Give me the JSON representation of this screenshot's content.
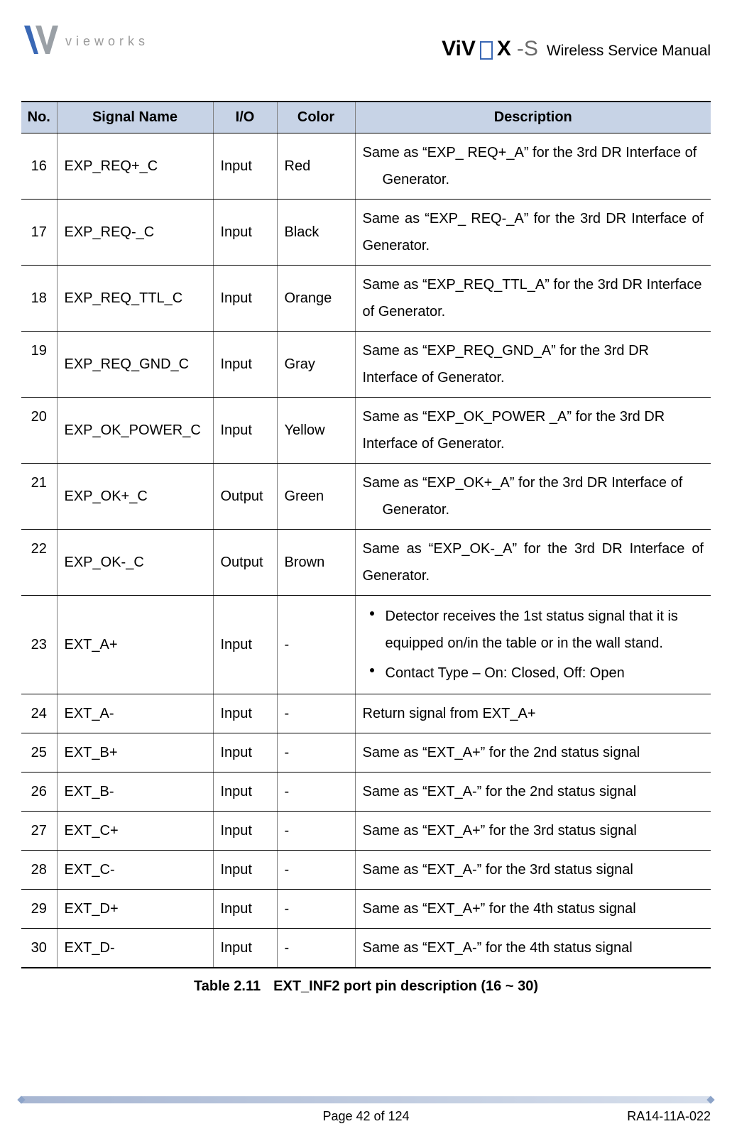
{
  "header": {
    "company_wordmark": "vieworks",
    "product_logo_text_left": "ViV",
    "product_logo_text_right": "X",
    "product_logo_suffix": "-S",
    "manual_title": "Wireless Service Manual"
  },
  "table": {
    "headers": {
      "no": "No.",
      "signal": "Signal Name",
      "io": "I/O",
      "color": "Color",
      "description": "Description"
    },
    "rows": [
      {
        "no": "16",
        "signal": "EXP_REQ+_C",
        "io": "Input",
        "color": "Red",
        "desc_prefix": "Same as “EXP_ REQ+_A” for the 3rd DR Interface of",
        "desc_indent": "Generator."
      },
      {
        "no": "17",
        "signal": "EXP_REQ-_C",
        "io": "Input",
        "color": "Black",
        "desc": "Same as “EXP_ REQ-_A” for the 3rd DR Interface of Generator.",
        "justify": true
      },
      {
        "no": "18",
        "signal": "EXP_REQ_TTL_C",
        "io": "Input",
        "color": "Orange",
        "desc": "Same as “EXP_REQ_TTL_A” for the 3rd DR Interface of Generator."
      },
      {
        "no": "19",
        "signal": "EXP_REQ_GND_C",
        "io": "Input",
        "color": "Gray",
        "desc": "Same as “EXP_REQ_GND_A” for the 3rd DR Interface of Generator.",
        "no_top": true
      },
      {
        "no": "20",
        "signal": "EXP_OK_POWER_C",
        "io": "Input",
        "color": "Yellow",
        "desc": "Same as “EXP_OK_POWER _A” for the 3rd DR Interface of Generator.",
        "no_top": true
      },
      {
        "no": "21",
        "signal": "EXP_OK+_C",
        "io": "Output",
        "color": "Green",
        "desc_prefix": "Same as “EXP_OK+_A” for the 3rd DR Interface of",
        "desc_indent": "Generator.",
        "no_top": true
      },
      {
        "no": "22",
        "signal": "EXP_OK-_C",
        "io": "Output",
        "color": "Brown",
        "desc": "Same as “EXP_OK-_A” for the 3rd DR Interface of Generator.",
        "justify": true,
        "no_top": true
      },
      {
        "no": "23",
        "signal": "EXT_A+",
        "io": "Input",
        "color": "-",
        "bullets": [
          "Detector receives the 1st status signal that it is equipped on/in the table or in the wall stand.",
          "Contact Type – On: Closed, Off: Open"
        ]
      },
      {
        "no": "24",
        "signal": "EXT_A-",
        "io": "Input",
        "color": "-",
        "desc": "Return signal from EXT_A+"
      },
      {
        "no": "25",
        "signal": "EXT_B+",
        "io": "Input",
        "color": "-",
        "desc": "Same as “EXT_A+” for the 2nd status signal"
      },
      {
        "no": "26",
        "signal": "EXT_B-",
        "io": "Input",
        "color": "-",
        "desc": "Same as “EXT_A-” for the 2nd status signal"
      },
      {
        "no": "27",
        "signal": "EXT_C+",
        "io": "Input",
        "color": "-",
        "desc": "Same as “EXT_A+” for the 3rd status signal"
      },
      {
        "no": "28",
        "signal": "EXT_C-",
        "io": "Input",
        "color": "-",
        "desc": "Same as “EXT_A-” for the 3rd status signal"
      },
      {
        "no": "29",
        "signal": "EXT_D+",
        "io": "Input",
        "color": "-",
        "desc": "Same as “EXT_A+” for the 4th status signal"
      },
      {
        "no": "30",
        "signal": "EXT_D-",
        "io": "Input",
        "color": "-",
        "desc": "Same as “EXT_A-” for the 4th status signal"
      }
    ]
  },
  "caption": {
    "label": "Table 2.11",
    "text": "EXT_INF2 port pin description (16 ~ 30)"
  },
  "footer": {
    "page": "Page 42 of 124",
    "doc_id": "RA14-11A-022"
  }
}
